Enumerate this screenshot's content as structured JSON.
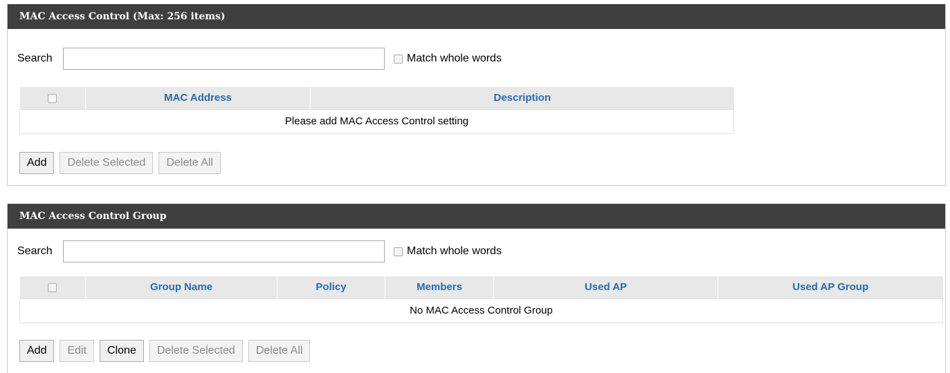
{
  "mac_access_control": {
    "title": "MAC Access Control (Max: 256 items)",
    "search_label": "Search",
    "search_value": "",
    "match_label": "Match whole words",
    "columns": [
      "MAC Address",
      "Description"
    ],
    "empty_message": "Please add MAC Access Control setting",
    "buttons": {
      "add": "Add",
      "delete_selected": "Delete Selected",
      "delete_all": "Delete All"
    }
  },
  "mac_access_control_group": {
    "title": "MAC Access Control Group",
    "search_label": "Search",
    "search_value": "",
    "match_label": "Match whole words",
    "columns": [
      "Group Name",
      "Policy",
      "Members",
      "Used AP",
      "Used AP Group"
    ],
    "empty_message": "No MAC Access Control Group",
    "buttons": {
      "add": "Add",
      "edit": "Edit",
      "clone": "Clone",
      "delete_selected": "Delete Selected",
      "delete_all": "Delete All"
    }
  },
  "colors": {
    "header_bg": "#3f3f3f",
    "column_header_text": "#2a6aad",
    "column_header_bg": "#e8e8e8"
  }
}
